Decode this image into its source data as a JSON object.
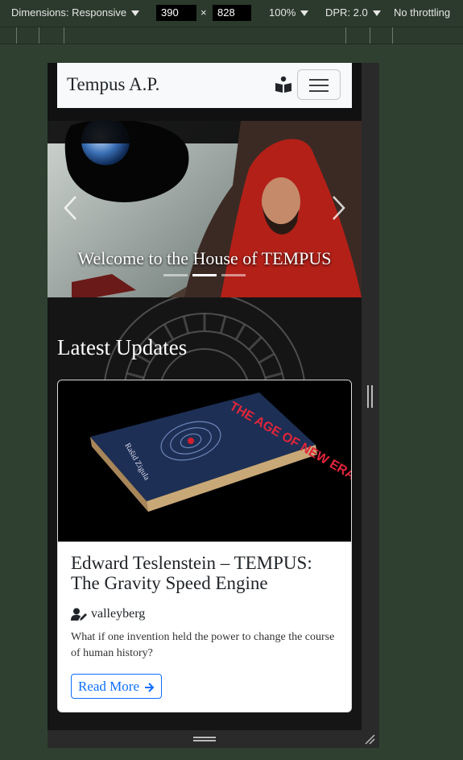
{
  "devtools": {
    "dimensions_label": "Dimensions: Responsive",
    "width": "390",
    "times": "×",
    "height": "828",
    "zoom": "100%",
    "dpr": "DPR: 2.0",
    "throttling": "No throttling"
  },
  "navbar": {
    "brand": "Tempus A.P.",
    "book_icon": "book-reader-icon",
    "toggle_icon": "hamburger-icon"
  },
  "carousel": {
    "caption": "Welcome to the House of TEMPUS",
    "slide_count": 3,
    "active_slide": 2,
    "prev_icon": "chevron-left-icon",
    "next_icon": "chevron-right-icon"
  },
  "section": {
    "title": "Latest Updates"
  },
  "post": {
    "book_cover_title": "THE AGE OF NEW ERA",
    "book_cover_author": "Rašid Zigula",
    "title": "Edward Teslenstein – TEMPUS: The Gravity Speed Engine",
    "author_icon": "user-edit-icon",
    "author": "valleyberg",
    "excerpt": "What if one invention held the power to change the course of human history?",
    "read_more": "Read More",
    "read_more_icon": "arrow-right-icon"
  },
  "colors": {
    "primary": "#0d6efd",
    "navbar_bg": "#f8f9fa",
    "page_bg": "#2f4030"
  }
}
